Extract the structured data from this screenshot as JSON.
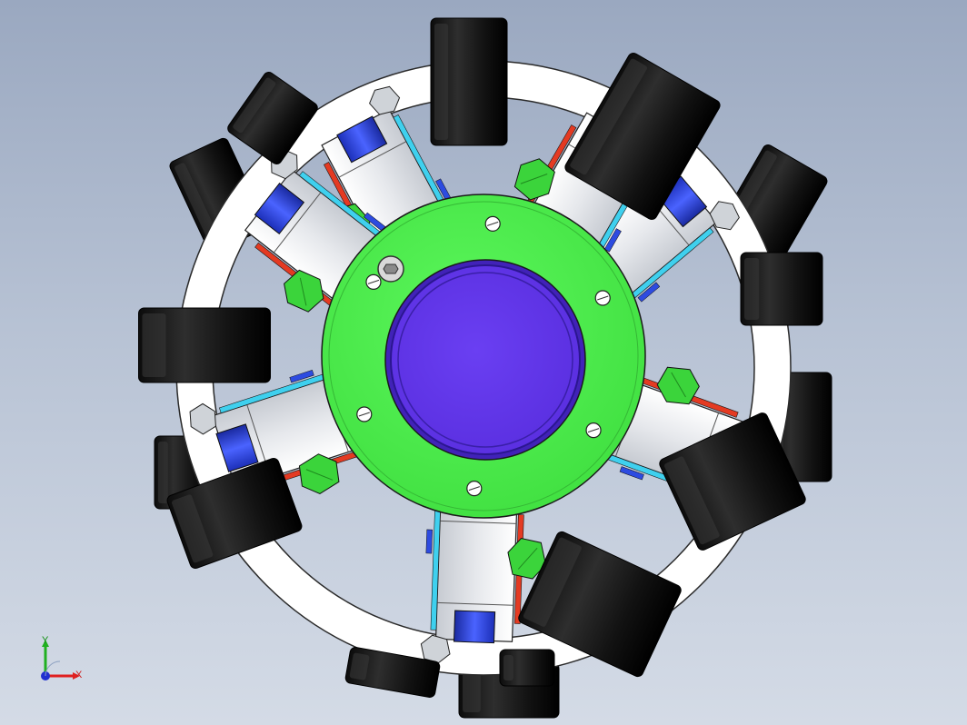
{
  "viewport": {
    "background_top": "#9aa8c0",
    "background_bottom": "#d4dbe6"
  },
  "model": {
    "hub_color": "#4cf04c",
    "cap_color": "#6a3cf0",
    "roller_color": "#1a1a1a",
    "frame_color": "#ffffff",
    "bracket_colors": [
      "#2d4be0",
      "#3fd0ee",
      "#e43a22",
      "#3bd43b"
    ],
    "hub_holes": 6,
    "roller_count": 10
  },
  "triad": {
    "x_label": "X",
    "y_label": "Y",
    "x_color": "#e02020",
    "y_color": "#20b020",
    "z_color": "#2030d0"
  }
}
